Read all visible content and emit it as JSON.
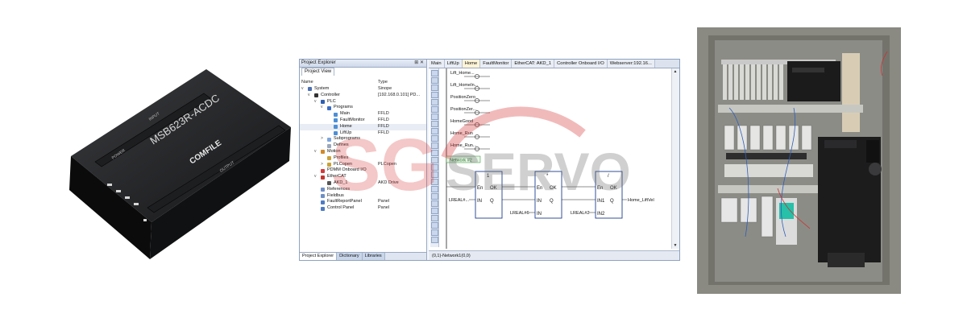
{
  "product": {
    "brand": "COMFILE",
    "model": "MSB623R-ACDC",
    "labels": {
      "output": "OUTPUT",
      "input": "INPUT",
      "power": "POWER"
    }
  },
  "explorer": {
    "title": "Project Explorer",
    "title_buttons": "⊞ ✕",
    "view_tab": "Project View",
    "col_name": "Name",
    "col_type": "Type",
    "tree": [
      {
        "name": "System",
        "type": "Sinope"
      },
      {
        "name": "Controller",
        "type": "[192.168.0.101] PD..."
      },
      {
        "name": "PLC",
        "type": ""
      },
      {
        "name": "Programs",
        "type": ""
      },
      {
        "name": "Main",
        "type": "FFLD"
      },
      {
        "name": "FaultMonitor",
        "type": "FFLD"
      },
      {
        "name": "Home",
        "type": "FFLD"
      },
      {
        "name": "LiftUp",
        "type": "FFLD"
      },
      {
        "name": "Subprograms",
        "type": ""
      },
      {
        "name": "Defines",
        "type": ""
      },
      {
        "name": "Motion",
        "type": ""
      },
      {
        "name": "Profiles",
        "type": ""
      },
      {
        "name": "PLCopen",
        "type": "PLCopen"
      },
      {
        "name": "PDMM Onboard I/O",
        "type": ""
      },
      {
        "name": "EtherCAT",
        "type": ""
      },
      {
        "name": "AKD_1",
        "type": "AKD Drive"
      },
      {
        "name": "References",
        "type": ""
      },
      {
        "name": "Fieldbus",
        "type": ""
      },
      {
        "name": "FaultReportPanel",
        "type": "Panel"
      },
      {
        "name": "Control Panel",
        "type": "Panel"
      }
    ],
    "bottom_tabs": [
      "Project Explorer",
      "Dictionary",
      "Libraries"
    ]
  },
  "editor": {
    "tabs": [
      "Main",
      "LiftUp",
      "Home",
      "FaultMonitor",
      "EtherCAT: AKD_1",
      "Controller Onboard I/O",
      "Webserver:192.16..."
    ],
    "active_tab": "Home",
    "coils": [
      "Lift_Home...",
      "Lift_HomeIn...",
      "PositionZero",
      "PositionZer...",
      "HomeGood",
      "Home_Run",
      "Home_Run..."
    ],
    "network_label": "Network #2",
    "blocks": [
      {
        "title": "1",
        "inputs": [
          "En",
          "IN"
        ],
        "outputs": [
          "OK",
          "Q"
        ]
      },
      {
        "title": "*",
        "inputs": [
          "En",
          "IN",
          "IN"
        ],
        "outputs": [
          "OK",
          "Q"
        ]
      },
      {
        "title": "/",
        "inputs": [
          "En",
          "IN1",
          "IN2"
        ],
        "outputs": [
          "OK",
          "Q"
        ]
      }
    ],
    "vars": {
      "in1": "LREAL#...",
      "in2": "LREAL#6",
      "in3": "LREAL#2",
      "out": "Home_LiftVel"
    },
    "status": "(0,1)-Network1(0,0)"
  },
  "watermark": {
    "text_a": "SG",
    "text_b": "SERVO"
  },
  "colors": {
    "watermark_red": "#d83a3a",
    "watermark_gray": "#6e6e6e",
    "ui_border": "#8da2c0"
  }
}
